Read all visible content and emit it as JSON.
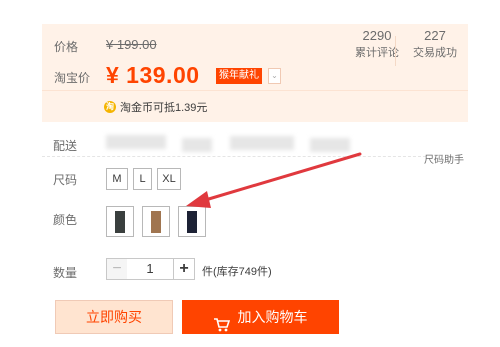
{
  "price_panel": {
    "price_label": "价格",
    "original_price": "¥ 199.00",
    "taobao_label": "淘宝价",
    "taobao_price": "¥ 139.00",
    "promo_tag": "猴年献礼",
    "promo_caret": "⌄",
    "stats": [
      {
        "value": "2290",
        "caption": "累计评论"
      },
      {
        "value": "227",
        "caption": "交易成功"
      }
    ],
    "coin_icon": "淘",
    "coin_text": "淘金币可抵1.39元"
  },
  "delivery": {
    "label": "配送"
  },
  "size": {
    "label": "尺码",
    "helper": "尺码助手",
    "options": [
      "M",
      "L",
      "XL"
    ]
  },
  "color": {
    "label": "颜色",
    "swatch_colors": [
      "#3a3f3e",
      "#a07550",
      "#1d2235"
    ]
  },
  "quantity": {
    "label": "数量",
    "minus": "−",
    "value": "1",
    "plus": "+",
    "stock": "件(库存749件)"
  },
  "actions": {
    "buy_now": "立即购买",
    "add_to_cart": "加入购物车"
  },
  "annotation": {
    "arrow_color": "#e0393e"
  }
}
